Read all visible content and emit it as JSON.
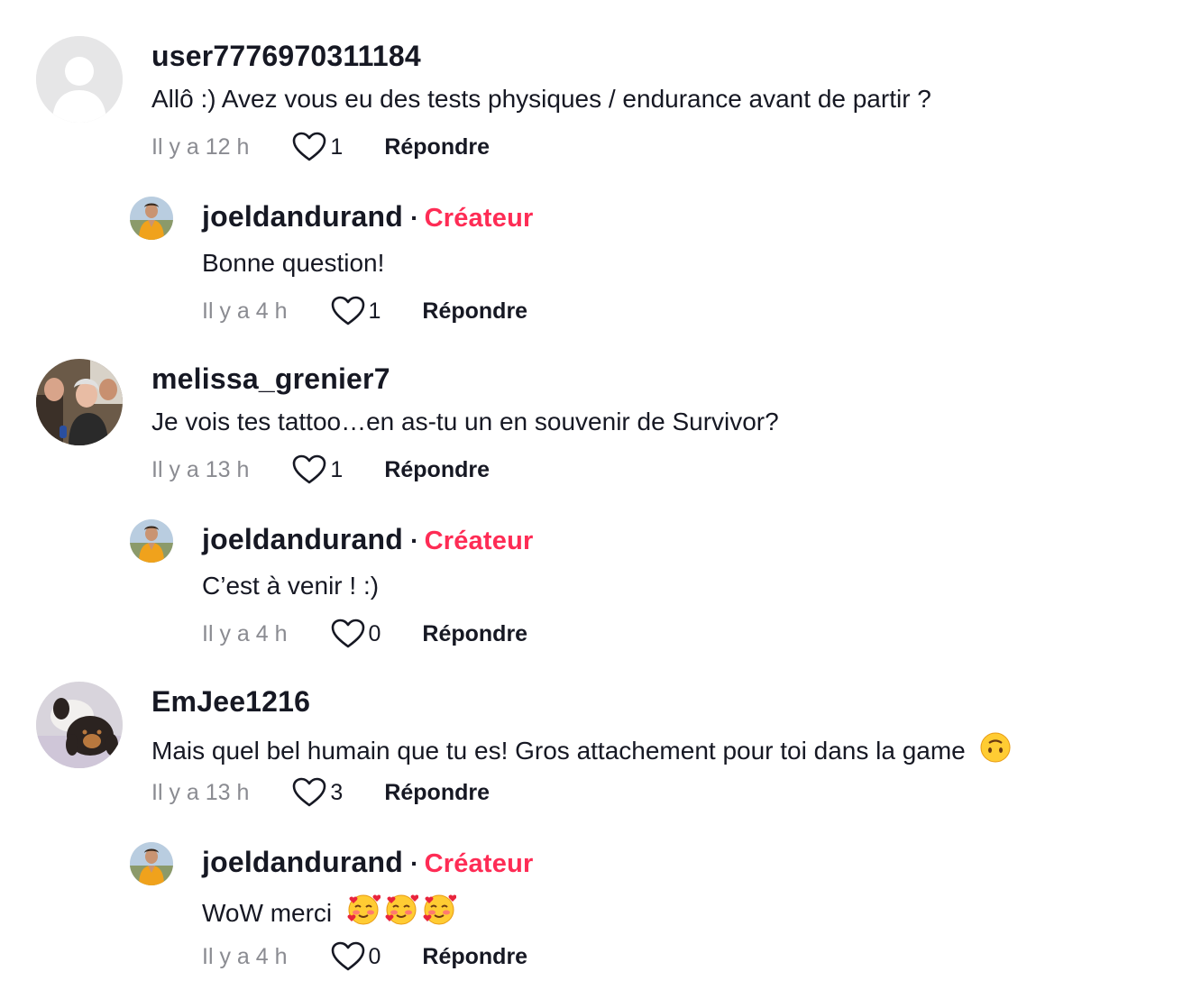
{
  "top_cut_text": "",
  "comments": [
    {
      "username": "user7776970311184",
      "text": "Allô :) Avez vous eu des tests physiques / endurance avant de partir ?",
      "time": "Il y a 12 h",
      "likes": "1",
      "reply_label": "Répondre",
      "avatar": "default-avatar-icon",
      "reply": {
        "username": "joeldandurand",
        "separator": "·",
        "badge": "Créateur",
        "text": "Bonne question!",
        "time": "Il y a 4 h",
        "likes": "1",
        "reply_label": "Répondre"
      }
    },
    {
      "username": "melissa_grenier7",
      "text": "Je vois tes tattoo…en as-tu un en souvenir de Survivor?",
      "time": "Il y a 13 h",
      "likes": "1",
      "reply_label": "Répondre",
      "avatar": "group-photo-avatar",
      "reply": {
        "username": "joeldandurand",
        "separator": "·",
        "badge": "Créateur",
        "text": "C’est à venir ! :)",
        "time": "Il y a 4 h",
        "likes": "0",
        "reply_label": "Répondre"
      }
    },
    {
      "username": "EmJee1216",
      "text": "Mais quel bel humain que tu es! Gros attachement pour toi dans la game",
      "text_emoji": "upside-down-face-emoji",
      "time": "Il y a 13 h",
      "likes": "3",
      "reply_label": "Répondre",
      "avatar": "dog-photo-avatar",
      "reply": {
        "username": "joeldandurand",
        "separator": "·",
        "badge": "Créateur",
        "text": "WoW merci",
        "text_emoji": "smiling-face-with-hearts-emoji x3",
        "time": "Il y a 4 h",
        "likes": "0",
        "reply_label": "Répondre"
      }
    }
  ],
  "colors": {
    "creator_badge": "#fe2c55",
    "text": "#161823",
    "muted": "#8a8b91"
  }
}
